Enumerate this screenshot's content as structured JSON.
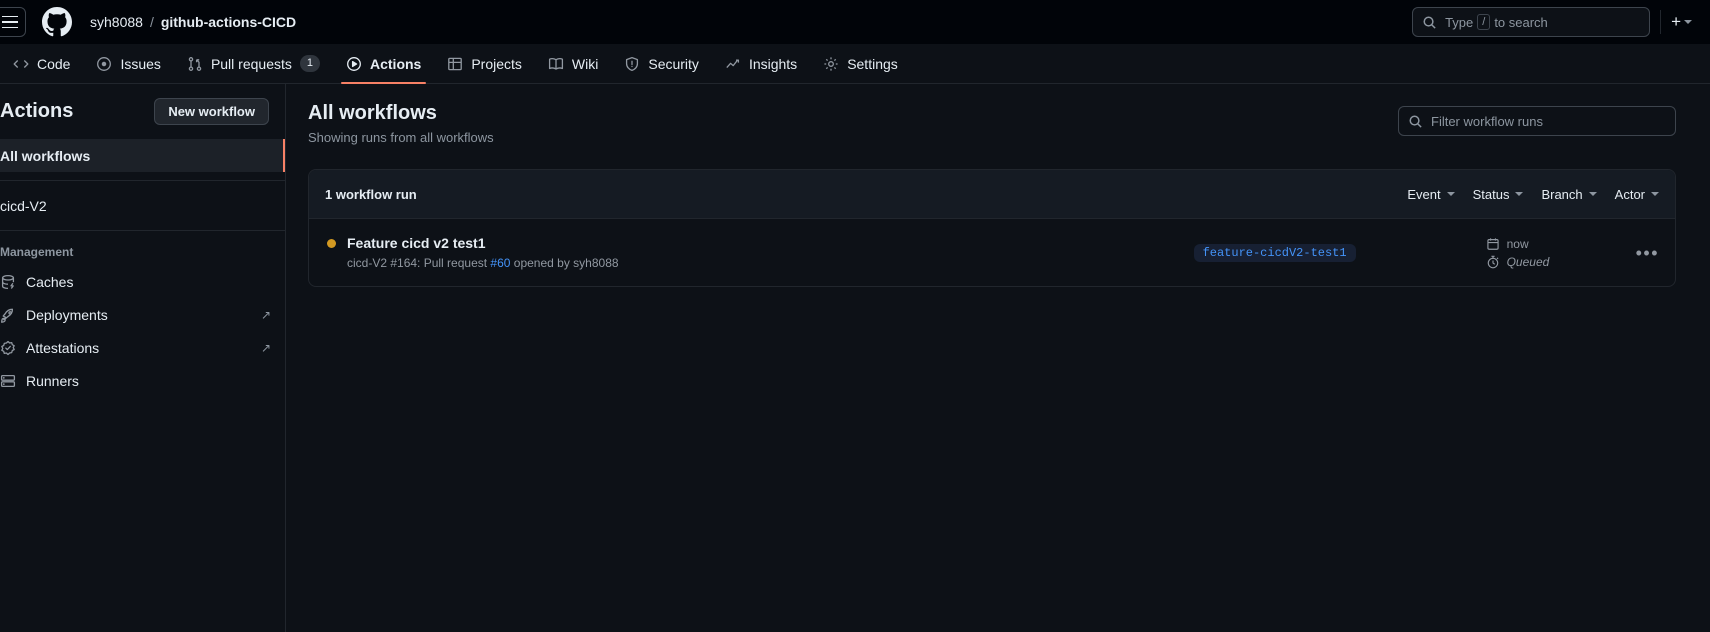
{
  "header": {
    "menu_icon": "hamburger-icon",
    "logo_icon": "github-logo-icon",
    "owner": "syh8088",
    "separator": "/",
    "repo": "github-actions-CICD",
    "search_placeholder": "Type",
    "search_key": "/",
    "search_suffix": "to search",
    "plus_label": "+"
  },
  "repo_nav": {
    "items": [
      {
        "label": "Code",
        "icon": "code-icon",
        "count": null,
        "active": false
      },
      {
        "label": "Issues",
        "icon": "issue-opened-icon",
        "count": null,
        "active": false
      },
      {
        "label": "Pull requests",
        "icon": "git-pull-request-icon",
        "count": "1",
        "active": false
      },
      {
        "label": "Actions",
        "icon": "play-icon",
        "count": null,
        "active": true
      },
      {
        "label": "Projects",
        "icon": "table-icon",
        "count": null,
        "active": false
      },
      {
        "label": "Wiki",
        "icon": "book-icon",
        "count": null,
        "active": false
      },
      {
        "label": "Security",
        "icon": "shield-icon",
        "count": null,
        "active": false
      },
      {
        "label": "Insights",
        "icon": "graph-icon",
        "count": null,
        "active": false
      },
      {
        "label": "Settings",
        "icon": "gear-icon",
        "count": null,
        "active": false
      }
    ]
  },
  "sidebar": {
    "title": "Actions",
    "new_workflow_label": "New workflow",
    "all_workflows_label": "All workflows",
    "workflows": [
      {
        "label": "cicd-V2"
      }
    ],
    "management_label": "Management",
    "management_items": [
      {
        "label": "Caches",
        "icon": "cache-icon",
        "external": false
      },
      {
        "label": "Deployments",
        "icon": "rocket-icon",
        "external": true
      },
      {
        "label": "Attestations",
        "icon": "verified-icon",
        "external": true
      },
      {
        "label": "Runners",
        "icon": "server-icon",
        "external": false
      }
    ],
    "external_glyph": "↗"
  },
  "main": {
    "title": "All workflows",
    "subtitle": "Showing runs from all workflows",
    "filter_placeholder": "Filter workflow runs",
    "runs_count_label": "1 workflow run",
    "filters": [
      {
        "label": "Event"
      },
      {
        "label": "Status"
      },
      {
        "label": "Branch"
      },
      {
        "label": "Actor"
      }
    ],
    "runs": [
      {
        "status": "queued",
        "status_color": "#d29922",
        "title": "Feature cicd v2 test1",
        "subtitle_prefix": "cicd-V2 #164: Pull request ",
        "subtitle_link": "#60",
        "subtitle_suffix": " opened by syh8088",
        "branch": "feature-cicdV2-test1",
        "time": "now",
        "time_icon": "calendar-icon",
        "duration": "Queued",
        "duration_icon": "stopwatch-icon",
        "menu_glyph": "•••"
      }
    ]
  },
  "colors": {
    "accent": "#f78166",
    "link": "#4493f8",
    "queued": "#d29922",
    "background": "#0d1117",
    "header_bg": "#010409"
  }
}
